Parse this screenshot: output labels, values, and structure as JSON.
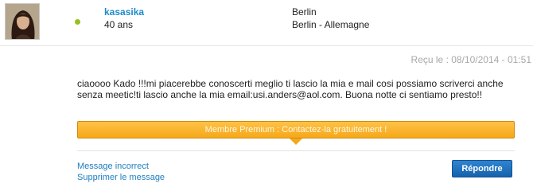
{
  "sender": {
    "username": "kasasika",
    "age": "40 ans",
    "city": "Berlin",
    "region": "Berlin - Allemagne",
    "online": true
  },
  "message": {
    "received_label": "Reçu le : 08/10/2014 - 01:51",
    "body": "ciaoooo Kado !!!mi piacerebbe conoscerti meglio ti lascio la mia e mail cosi possiamo scriverci anche senza meetic!ti lascio anche la mia email:usi.anders@aol.com. Buona notte ci sentiamo presto!!"
  },
  "premium_banner": {
    "text": "Membre Premium : Contactez-la gratuitement !"
  },
  "actions": {
    "report_label": "Message incorrect",
    "delete_label": "Supprimer le message",
    "reply_label": "Répondre"
  },
  "colors": {
    "link": "#1d8acc",
    "online": "#97c11c",
    "premium": "#f5a81a",
    "button": "#1562ac"
  }
}
